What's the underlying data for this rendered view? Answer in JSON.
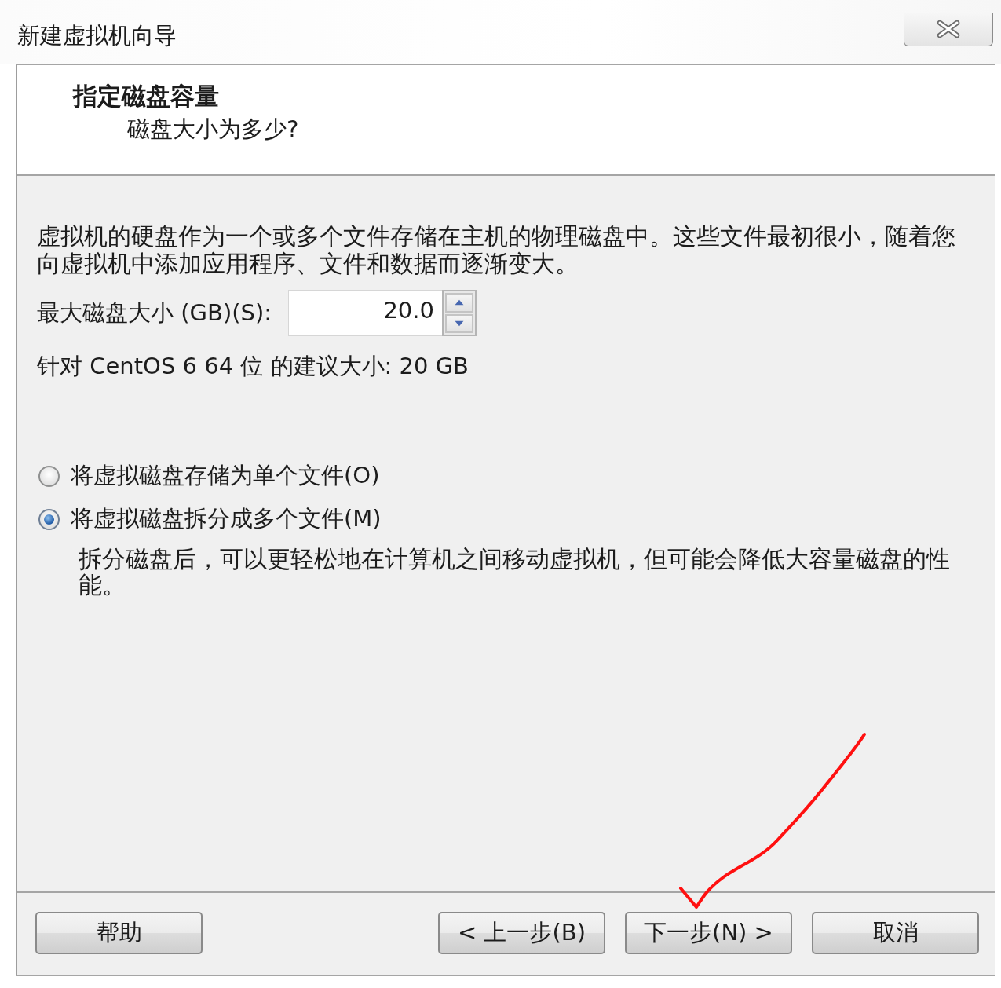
{
  "window": {
    "title": "新建虚拟机向导"
  },
  "header": {
    "title": "指定磁盘容量",
    "subtitle": "磁盘大小为多少?"
  },
  "body": {
    "description": "虚拟机的硬盘作为一个或多个文件存储在主机的物理磁盘中。这些文件最初很小，随着您向虚拟机中添加应用程序、文件和数据而逐渐变大。",
    "disk_size": {
      "label": "最大磁盘大小 (GB)(S):",
      "value": "20.0"
    },
    "recommendation": "针对 CentOS 6 64 位 的建议大小: 20 GB"
  },
  "storage_options": [
    {
      "label": "将虚拟磁盘存储为单个文件(O)",
      "selected": false
    },
    {
      "label": "将虚拟磁盘拆分成多个文件(M)",
      "selected": true,
      "description": "拆分磁盘后，可以更轻松地在计算机之间移动虚拟机，但可能会降低大容量磁盘的性能。"
    }
  ],
  "footer": {
    "left_buttons": [
      {
        "label": "帮助"
      }
    ],
    "right_buttons": [
      {
        "label": "< 上一步(B)"
      },
      {
        "label": "下一步(N) >"
      },
      {
        "label": "取消"
      }
    ]
  },
  "annotations": [
    {
      "kind": "arrow"
    }
  ]
}
